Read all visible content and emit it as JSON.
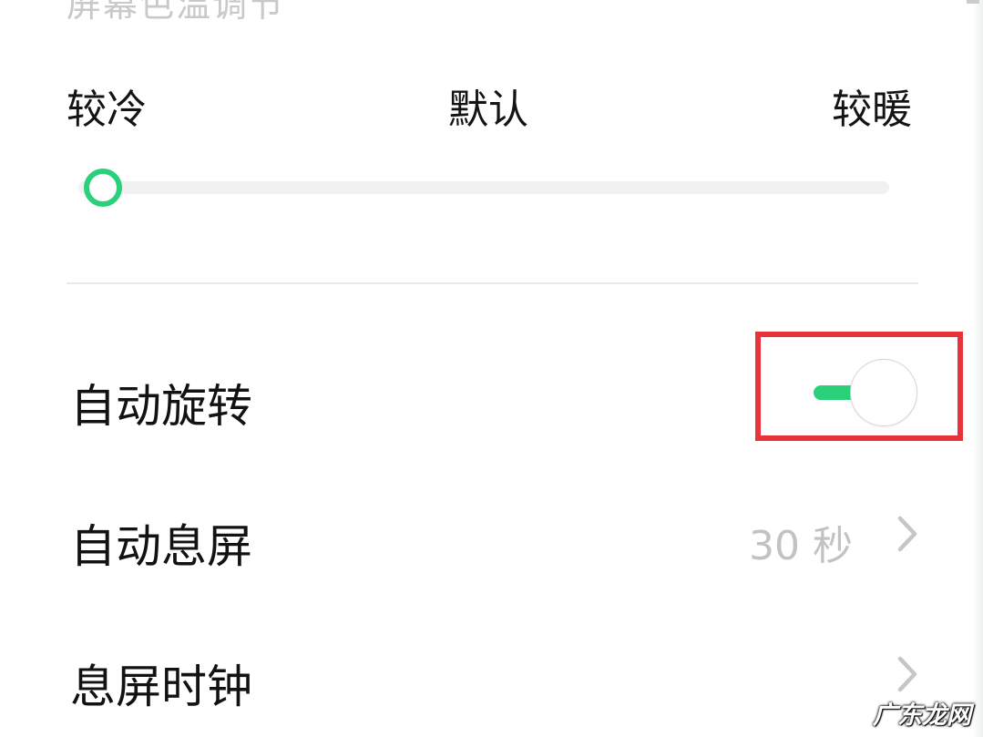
{
  "display": {
    "section_title": "屏幕色温调节",
    "color_temperature": {
      "cold_label": "较冷",
      "default_label": "默认",
      "warm_label": "较暖",
      "slider_level": 0.03
    }
  },
  "settings": {
    "auto_rotate": {
      "label": "自动旋转",
      "enabled": false
    },
    "auto_screen_off": {
      "label": "自动息屏",
      "value": "30 秒"
    },
    "screen_off_clock": {
      "label": "息屏时钟"
    }
  },
  "highlight": {
    "color": "#e8333a",
    "target": "auto_rotate_toggle"
  },
  "colors": {
    "accent": "#2bd07b",
    "secondary_text": "#c2c2c2"
  },
  "watermark": {
    "text": "广东龙网"
  }
}
